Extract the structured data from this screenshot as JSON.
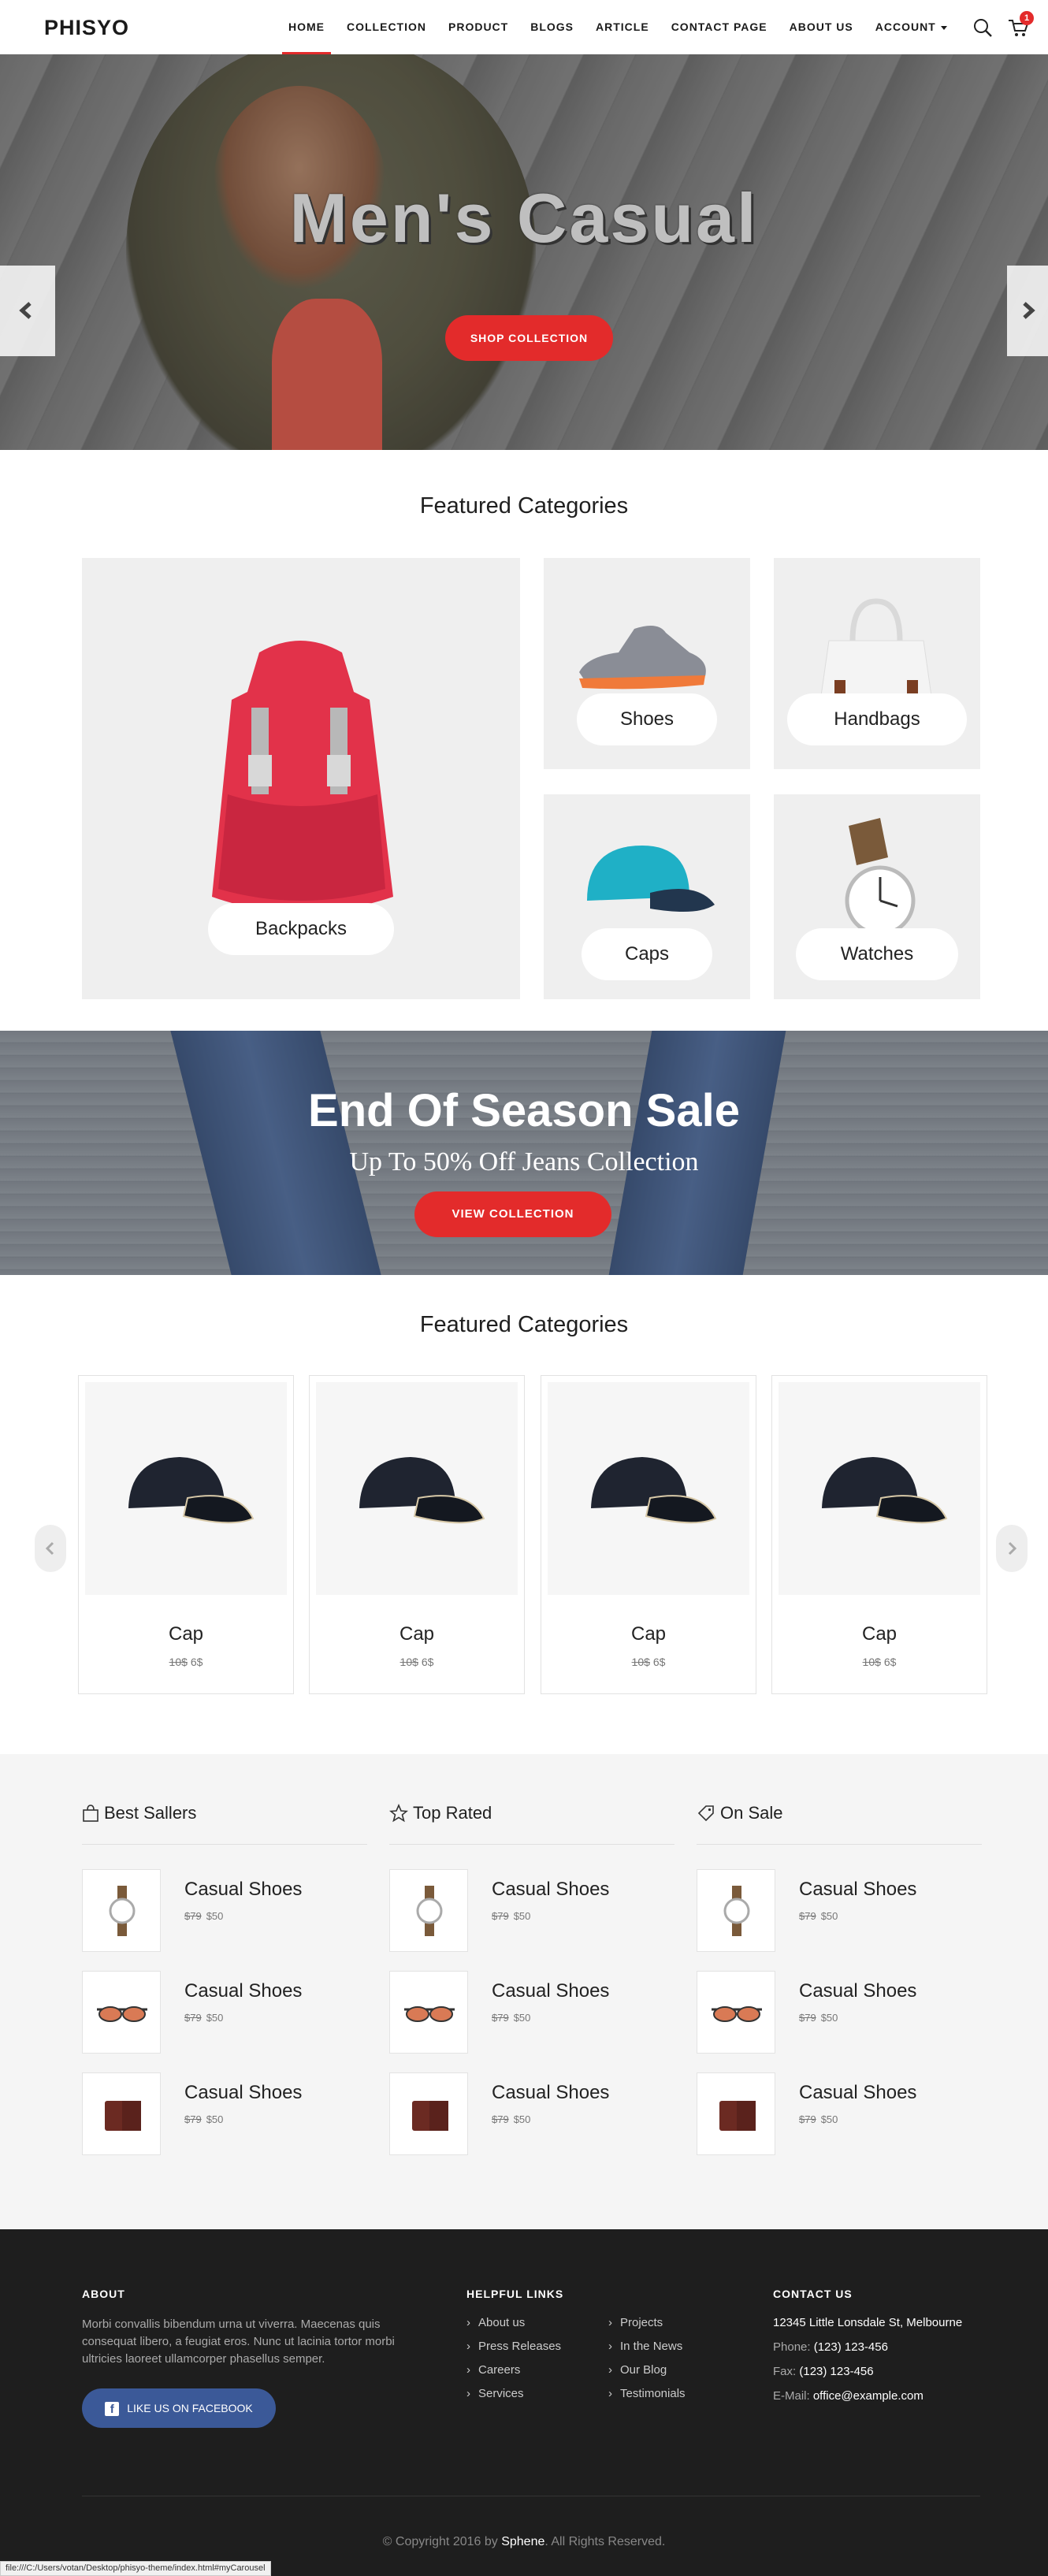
{
  "nav": {
    "logo": "PHISYO",
    "items": [
      {
        "label": "HOME"
      },
      {
        "label": "COLLECTION"
      },
      {
        "label": "PRODUCT"
      },
      {
        "label": "BLOGS"
      },
      {
        "label": "ARTICLE"
      },
      {
        "label": "CONTACT PAGE"
      },
      {
        "label": "ABOUT US"
      },
      {
        "label": "ACCOUNT"
      }
    ],
    "active_item": "HOME",
    "cart_count": "1",
    "search_icon": "search-icon",
    "cart_icon": "cart-icon"
  },
  "hero": {
    "title": "Men's Casual",
    "button": "SHOP COLLECTION",
    "slides": 2,
    "active_slide": 1
  },
  "categories": {
    "title": "Featured Categories",
    "items": [
      {
        "label": "Backpacks"
      },
      {
        "label": "Shoes"
      },
      {
        "label": "Handbags"
      },
      {
        "label": "Caps"
      },
      {
        "label": "Watches"
      }
    ]
  },
  "sale": {
    "title": "End Of Season Sale",
    "subtitle": "Up To 50% Off Jeans Collection",
    "button": "VIEW COLLECTION"
  },
  "products": {
    "title": "Featured Categories",
    "items": [
      {
        "name": "Cap",
        "old_price": "10$",
        "price": "6$"
      },
      {
        "name": "Cap",
        "old_price": "10$",
        "price": "6$"
      },
      {
        "name": "Cap",
        "old_price": "10$",
        "price": "6$"
      },
      {
        "name": "Cap",
        "old_price": "10$",
        "price": "6$"
      }
    ]
  },
  "lists": [
    {
      "title": "Best Sallers",
      "icon": "shopping-bag-icon",
      "items": [
        {
          "name": "Casual Shoes",
          "old_price": "$79",
          "price": "$50",
          "thumb": "watch"
        },
        {
          "name": "Casual Shoes",
          "old_price": "$79",
          "price": "$50",
          "thumb": "sunglasses"
        },
        {
          "name": "Casual Shoes",
          "old_price": "$79",
          "price": "$50",
          "thumb": "wallet"
        }
      ]
    },
    {
      "title": "Top Rated",
      "icon": "star-icon",
      "items": [
        {
          "name": "Casual Shoes",
          "old_price": "$79",
          "price": "$50",
          "thumb": "watch"
        },
        {
          "name": "Casual Shoes",
          "old_price": "$79",
          "price": "$50",
          "thumb": "sunglasses"
        },
        {
          "name": "Casual Shoes",
          "old_price": "$79",
          "price": "$50",
          "thumb": "wallet"
        }
      ]
    },
    {
      "title": "On Sale",
      "icon": "tag-icon",
      "items": [
        {
          "name": "Casual Shoes",
          "old_price": "$79",
          "price": "$50",
          "thumb": "watch"
        },
        {
          "name": "Casual Shoes",
          "old_price": "$79",
          "price": "$50",
          "thumb": "sunglasses"
        },
        {
          "name": "Casual Shoes",
          "old_price": "$79",
          "price": "$50",
          "thumb": "wallet"
        }
      ]
    }
  ],
  "footer": {
    "about": {
      "title": "ABOUT",
      "text": "Morbi convallis bibendum urna ut viverra. Maecenas quis consequat libero, a feugiat eros. Nunc ut lacinia tortor morbi ultricies laoreet ullamcorper phasellus semper.",
      "facebook_button": "LIKE US ON FACEBOOK"
    },
    "links": {
      "title": "HELPFUL LINKS",
      "col1": [
        "About us",
        "Press Releases",
        "Careers",
        "Services"
      ],
      "col2": [
        "Projects",
        "In the News",
        "Our Blog",
        "Testimonials"
      ]
    },
    "contact": {
      "title": "CONTACT US",
      "address": "12345 Little Lonsdale St, Melbourne",
      "phone_label": "Phone:",
      "phone": "(123) 123-456",
      "fax_label": "Fax:",
      "fax": "(123) 123-456",
      "email_label": "E-Mail:",
      "email": "office@example.com"
    },
    "copyright_prefix": "© Copyright 2016 by",
    "copyright_brand": "Sphene",
    "copyright_suffix": ". All Rights Reserved."
  },
  "status_bar": "file:///C:/Users/votan/Desktop/phisyo-theme/index.html#myCarousel",
  "colors": {
    "accent": "#e32b2b",
    "footer_bg": "#1e1e1e",
    "facebook": "#3b5998"
  }
}
